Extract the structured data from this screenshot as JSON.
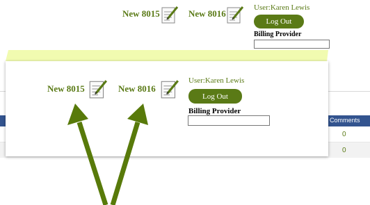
{
  "header": {
    "new_items": [
      {
        "label": "New 8015",
        "icon": "notepad-pencil-icon"
      },
      {
        "label": "New 8016",
        "icon": "notepad-pencil-icon"
      }
    ],
    "user_label": "User:Karen Lewis",
    "logout_label": "Log Out",
    "billing_provider_label": "Billing Provider",
    "billing_provider_value": ""
  },
  "table": {
    "comments_header": "Comments",
    "rows": [
      {
        "comments": "0"
      },
      {
        "comments": "0"
      }
    ]
  },
  "colors": {
    "accent_green": "#5a7a16",
    "highlight_yellow": "#f1fbb0",
    "table_header_blue": "#33548f",
    "arrow_green": "#587a0a"
  }
}
